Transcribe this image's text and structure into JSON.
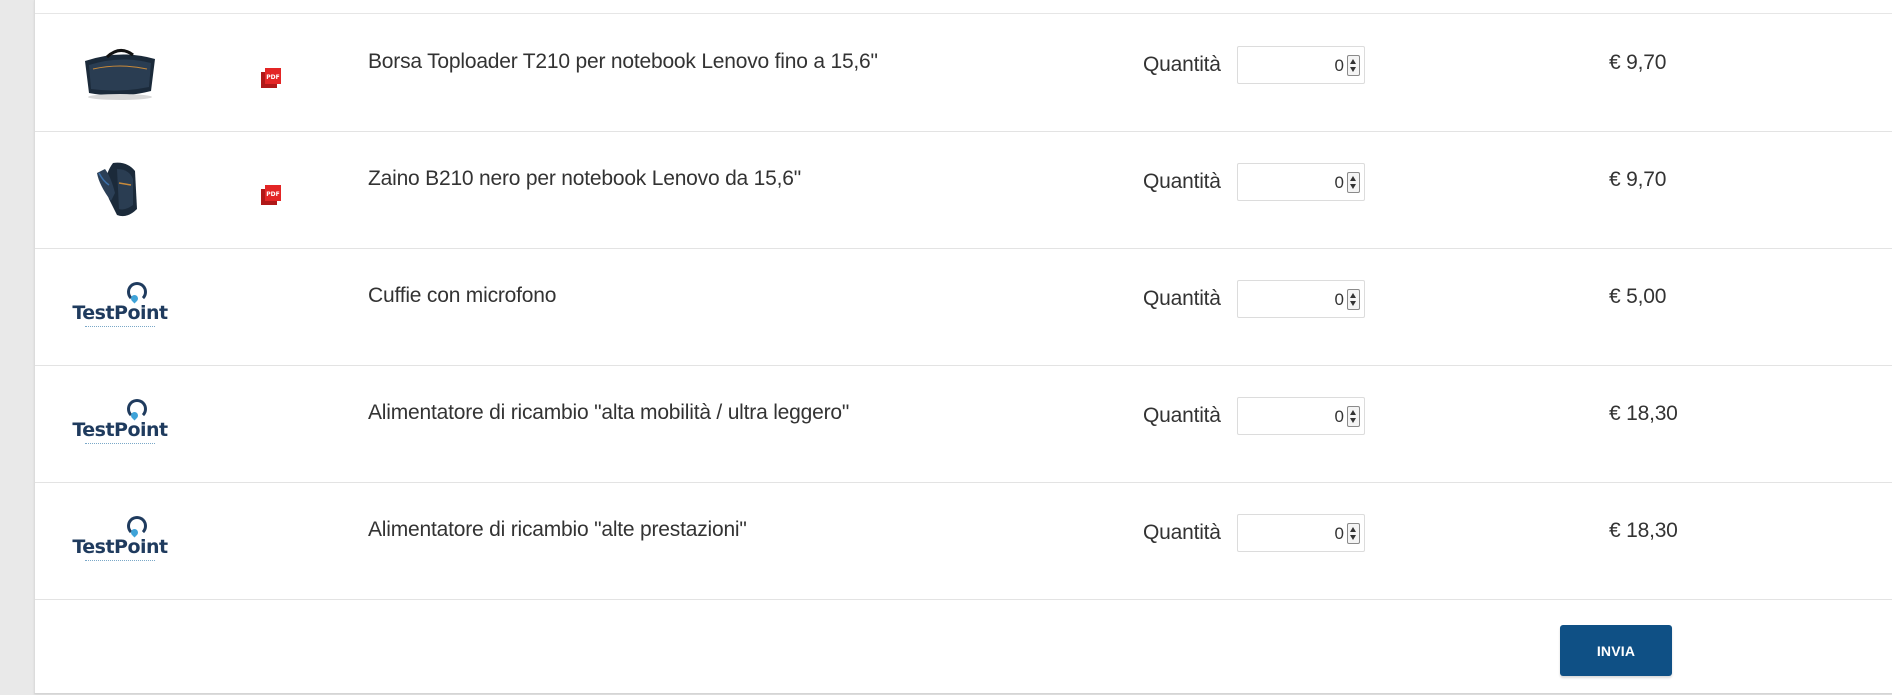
{
  "products": [
    {
      "name": "Borsa Toploader T210 per notebook Lenovo fino a 15,6\"",
      "image": "laptop-bag-image",
      "has_pdf": true,
      "quantity_label": "Quantità",
      "quantity": "0",
      "price": "€ 9,70"
    },
    {
      "name": "Zaino B210 nero per notebook Lenovo da 15,6\"",
      "image": "backpack-image",
      "has_pdf": true,
      "quantity_label": "Quantità",
      "quantity": "0",
      "price": "€ 9,70"
    },
    {
      "name": "Cuffie con microfono",
      "image": "testpoint-logo",
      "brand": "TestPoint",
      "has_pdf": false,
      "quantity_label": "Quantità",
      "quantity": "0",
      "price": "€ 5,00"
    },
    {
      "name": "Alimentatore di ricambio \"alta mobilità / ultra leggero\"",
      "image": "testpoint-logo",
      "brand": "TestPoint",
      "has_pdf": false,
      "quantity_label": "Quantità",
      "quantity": "0",
      "price": "€ 18,30"
    },
    {
      "name": "Alimentatore di ricambio \"alte prestazioni\"",
      "image": "testpoint-logo",
      "brand": "TestPoint",
      "has_pdf": false,
      "quantity_label": "Quantità",
      "quantity": "0",
      "price": "€ 18,30"
    }
  ],
  "submit_label": "INVIA",
  "pdf_icon": "pdf-file-icon",
  "colors": {
    "button_bg": "#0f5085",
    "pdf_red": "#e32525",
    "brand_navy": "#1f3b5e",
    "brand_blue": "#3fa3d8",
    "text": "#333333",
    "divider": "#e3e3e3"
  }
}
